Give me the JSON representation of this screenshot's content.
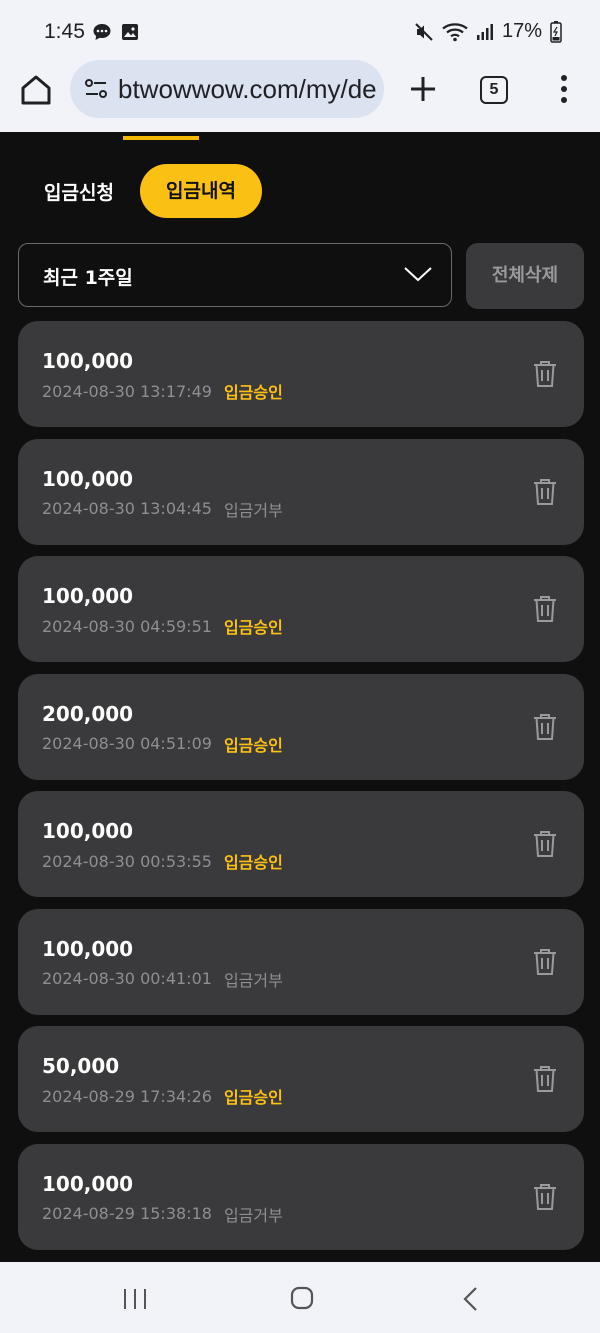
{
  "status_bar": {
    "time": "1:45",
    "battery": "17%"
  },
  "browser": {
    "url": "btwowwow.com/my/de",
    "tab_count": "5"
  },
  "tabs": {
    "apply": "입금신청",
    "history": "입금내역"
  },
  "filter": {
    "period": "최근 1주일",
    "delete_all": "전체삭제"
  },
  "records": [
    {
      "amount": "100,000",
      "datetime": "2024-08-30 13:17:49",
      "status": "입금승인",
      "approved": true
    },
    {
      "amount": "100,000",
      "datetime": "2024-08-30 13:04:45",
      "status": "입금거부",
      "approved": false
    },
    {
      "amount": "100,000",
      "datetime": "2024-08-30 04:59:51",
      "status": "입금승인",
      "approved": true
    },
    {
      "amount": "200,000",
      "datetime": "2024-08-30 04:51:09",
      "status": "입금승인",
      "approved": true
    },
    {
      "amount": "100,000",
      "datetime": "2024-08-30 00:53:55",
      "status": "입금승인",
      "approved": true
    },
    {
      "amount": "100,000",
      "datetime": "2024-08-30 00:41:01",
      "status": "입금거부",
      "approved": false
    },
    {
      "amount": "50,000",
      "datetime": "2024-08-29 17:34:26",
      "status": "입금승인",
      "approved": true
    },
    {
      "amount": "100,000",
      "datetime": "2024-08-29 15:38:18",
      "status": "입금거부",
      "approved": false
    }
  ],
  "colors": {
    "accent": "#fbc014",
    "card": "#3a3a3c",
    "background": "#0f0f0f"
  }
}
